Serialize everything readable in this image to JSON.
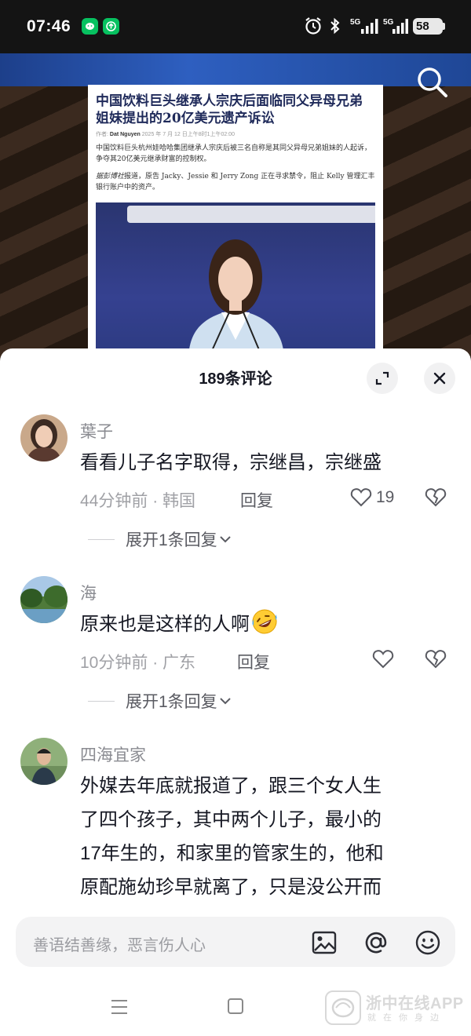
{
  "status_bar": {
    "time": "07:46",
    "battery": "58",
    "icons": [
      "wechat-icon",
      "app-update-icon",
      "alarm-icon",
      "bluetooth-icon",
      "signal-5g-icon",
      "signal-5g-icon",
      "battery-icon"
    ]
  },
  "article": {
    "title": "中国饮料巨头继承人宗庆后面临同父异母兄弟姐妹提出的20亿美元遗产诉讼",
    "author_label": "作者:",
    "author": "Dat Nguyen",
    "date": "2025 年 7 月 12 日上午8时1上午02:00",
    "para1": "中国饮料巨头杭州娃哈哈集团继承人宗庆后被三名自称是其同父异母兄弟姐妹的人起诉，争夺其20亿美元继承财富的控制权。",
    "para2_italic": "据彭博社",
    "para2": "报道，原告 Jacky、Jessie 和 Jerry Zong 正在寻求禁令，阻止 Kelly 管理汇丰银行账户中的资产。"
  },
  "comments_sheet": {
    "title": "189条评论",
    "comments": [
      {
        "username": "葉子",
        "text": "看看儿子名字取得，宗继昌，宗继盛",
        "time_location": "44分钟前 · 韩国",
        "reply_label": "回复",
        "like_count": "19",
        "expand_label": "展开1条回复"
      },
      {
        "username": "海",
        "text": "原来也是这样的人啊",
        "emoji": "rofl-emoji",
        "time_location": "10分钟前 · 广东",
        "reply_label": "回复",
        "like_count": "",
        "expand_label": "展开1条回复"
      },
      {
        "username": "四海宜家",
        "text_lines": [
          "外媒去年底就报道了，跟三个女人生",
          "了四个孩子，其中两个儿子，最小的",
          "17年生的，和家里的管家生的，他和",
          "原配施幼珍早就离了，只是没公开而"
        ]
      }
    ]
  },
  "input_bar": {
    "placeholder": "善语结善缘，恶言伤人心"
  },
  "watermark": {
    "title": "浙中在线APP",
    "subtitle": "就在你身边"
  },
  "colors": {
    "status_bar_bg": "#141414",
    "primary_text": "#161823",
    "secondary_text": "#8a8b91",
    "sheet_bg": "#ffffff",
    "input_bg": "#f3f3f4"
  }
}
